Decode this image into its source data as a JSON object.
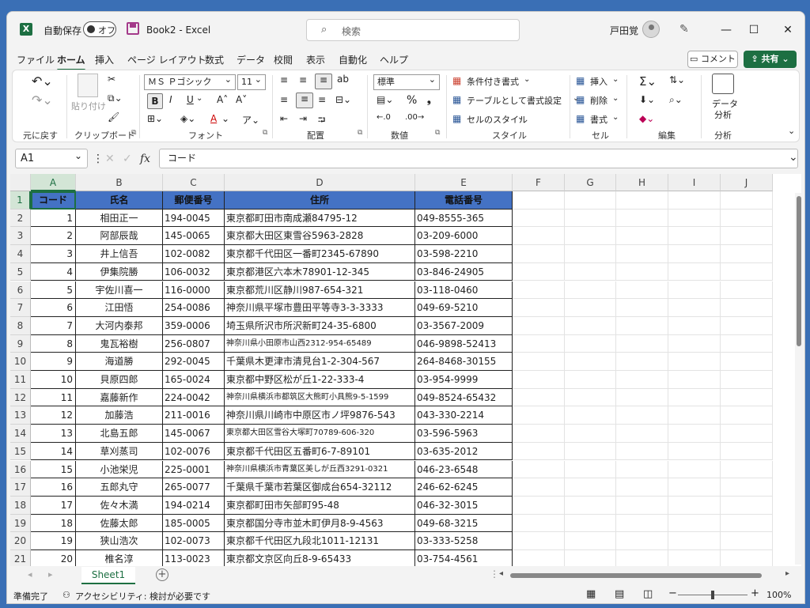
{
  "titlebar": {
    "logo": "X",
    "autosave_label": "自動保存",
    "autosave_state": "オフ",
    "file_title": "Book2  -  Excel",
    "search_placeholder": "検索",
    "user_name": "戸田覚",
    "minimize": "—",
    "maximize": "☐",
    "close": "✕"
  },
  "menu": {
    "tabs": [
      "ファイル",
      "ホーム",
      "挿入",
      "ページ レイアウト",
      "数式",
      "データ",
      "校閲",
      "表示",
      "自動化",
      "ヘルプ"
    ],
    "active": "ホーム",
    "comment_label": "コメント",
    "share_label": "共有"
  },
  "ribbon": {
    "groups": {
      "undo": "元に戻す",
      "clipboard": "クリップボード",
      "font": "フォント",
      "alignment": "配置",
      "number": "数値",
      "styles": "スタイル",
      "cells": "セル",
      "editing": "編集",
      "analysis": "分析"
    },
    "paste_label": "貼り付け",
    "font_name": "ＭＳ Ｐゴシック",
    "font_size": "11",
    "number_format": "標準",
    "conditional_format": "条件付き書式",
    "format_as_table": "テーブルとして書式設定",
    "cell_styles": "セルのスタイル",
    "insert": "挿入",
    "delete": "削除",
    "format": "書式",
    "analyze_data_1": "データ",
    "analyze_data_2": "分析",
    "bold": "B",
    "italic": "I",
    "underline": "U",
    "percent": "%"
  },
  "formula_bar": {
    "name_box": "A1",
    "fx": "fx",
    "content": "コード"
  },
  "grid": {
    "columns": [
      "A",
      "B",
      "C",
      "D",
      "E",
      "F",
      "G",
      "H",
      "I",
      "J"
    ],
    "row_numbers": [
      "1",
      "2",
      "3",
      "4",
      "5",
      "6",
      "7",
      "8",
      "9",
      "10",
      "11",
      "12",
      "13",
      "14",
      "15",
      "16",
      "17",
      "18",
      "19",
      "20",
      "21"
    ],
    "headers": [
      "コード",
      "氏名",
      "郵便番号",
      "住所",
      "電話番号"
    ],
    "rows": [
      [
        "1",
        "相田正一",
        "194-0045",
        "東京都町田市南成瀬84795-12",
        "049-8555-365"
      ],
      [
        "2",
        "阿部辰哉",
        "145-0065",
        "東京都大田区東雪谷5963-2828",
        "03-209-6000"
      ],
      [
        "3",
        "井上信吾",
        "102-0082",
        "東京都千代田区一番町2345-67890",
        "03-598-2210"
      ],
      [
        "4",
        "伊集院勝",
        "106-0032",
        "東京都港区六本木78901-12-345",
        "03-846-24905"
      ],
      [
        "5",
        "宇佐川喜一",
        "116-0000",
        "東京都荒川区静川987-654-321",
        "03-118-0460"
      ],
      [
        "6",
        "江田悟",
        "254-0086",
        "神奈川県平塚市豊田平等寺3-3-3333",
        "049-69-5210"
      ],
      [
        "7",
        "大河内泰邦",
        "359-0006",
        "埼玉県所沢市所沢新町24-35-6800",
        "03-3567-2009"
      ],
      [
        "8",
        "鬼瓦裕樹",
        "256-0807",
        "神奈川県小田原市山西2312-954-65489",
        "046-9898-52413"
      ],
      [
        "9",
        "海道勝",
        "292-0045",
        "千葉県木更津市清見台1-2-304-567",
        "264-8468-30155"
      ],
      [
        "10",
        "貝原四郎",
        "165-0024",
        "東京都中野区松が丘1-22-333-4",
        "03-954-9999"
      ],
      [
        "11",
        "嘉藤新作",
        "224-0042",
        "神奈川県横浜市都筑区大熊町小具熊9-5-1599",
        "049-8524-65432"
      ],
      [
        "12",
        "加藤浩",
        "211-0016",
        "神奈川県川崎市中原区市ノ坪9876-543",
        "043-330-2214"
      ],
      [
        "13",
        "北島五郎",
        "145-0067",
        "東京都大田区雪谷大塚町70789-606-320",
        "03-596-5963"
      ],
      [
        "14",
        "草刈蒸司",
        "102-0076",
        "東京都千代田区五番町6-7-89101",
        "03-635-2012"
      ],
      [
        "15",
        "小池栄児",
        "225-0001",
        "神奈川県横浜市青葉区美しが丘西3291-0321",
        "046-23-6548"
      ],
      [
        "16",
        "五郎丸守",
        "265-0077",
        "千葉県千葉市若葉区御成台654-32112",
        "246-62-6245"
      ],
      [
        "17",
        "佐々木満",
        "194-0214",
        "東京都町田市矢部町95-48",
        "046-32-3015"
      ],
      [
        "18",
        "佐藤太郎",
        "185-0005",
        "東京都国分寺市並木町伊月8-9-4563",
        "049-68-3215"
      ],
      [
        "19",
        "狭山浩次",
        "102-0073",
        "東京都千代田区九段北1011-12131",
        "03-333-5258"
      ],
      [
        "20",
        "椎名淳",
        "113-0023",
        "東京都文京区向丘8-9-65433",
        "03-754-4561"
      ]
    ]
  },
  "sheets": {
    "active": "Sheet1",
    "add": "+"
  },
  "status": {
    "ready": "準備完了",
    "accessibility": "アクセシビリティ: 検討が必要です",
    "zoom": "100%",
    "minus": "−",
    "plus": "+"
  },
  "colors": {
    "accent": "#1d6f42",
    "header_fill": "#4472c4"
  }
}
